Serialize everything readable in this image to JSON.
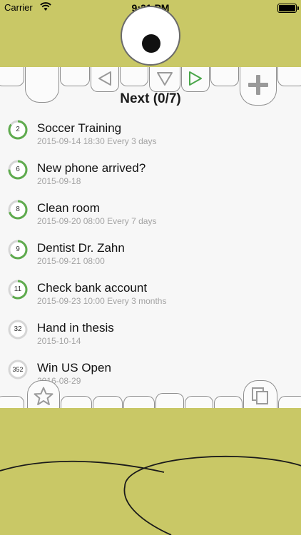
{
  "status_bar": {
    "carrier": "Carrier",
    "time": "9:21 PM"
  },
  "header": {
    "title": "Next (0/7)"
  },
  "toolbar": {
    "prev_icon": "triangle-left-icon",
    "down_icon": "triangle-down-icon",
    "next_icon": "triangle-right-icon",
    "add_icon": "plus-icon",
    "favorite_icon": "star-icon",
    "copy_icon": "copy-icon"
  },
  "colors": {
    "brand": "#c9c866",
    "progress": "#5fab4e",
    "next_arrow": "#4aa64a",
    "list_bg": "#f7f7f7"
  },
  "tasks": [
    {
      "count": "2",
      "title": "Soccer Training",
      "subtitle": "2015-09-14 18:30 Every 3 days",
      "progress": 0.85
    },
    {
      "count": "6",
      "title": "New phone arrived?",
      "subtitle": "2015-09-18",
      "progress": 0.75
    },
    {
      "count": "8",
      "title": "Clean room",
      "subtitle": "2015-09-20 08:00 Every 7 days",
      "progress": 0.7
    },
    {
      "count": "9",
      "title": "Dentist Dr. Zahn",
      "subtitle": "2015-09-21 08:00",
      "progress": 0.65
    },
    {
      "count": "11",
      "title": "Check bank account",
      "subtitle": "2015-09-23 10:00 Every 3 months",
      "progress": 0.6
    },
    {
      "count": "32",
      "title": "Hand in thesis",
      "subtitle": "2015-10-14",
      "progress": 0
    },
    {
      "count": "352",
      "title": "Win US Open",
      "subtitle": "2016-08-29",
      "progress": 0
    }
  ]
}
